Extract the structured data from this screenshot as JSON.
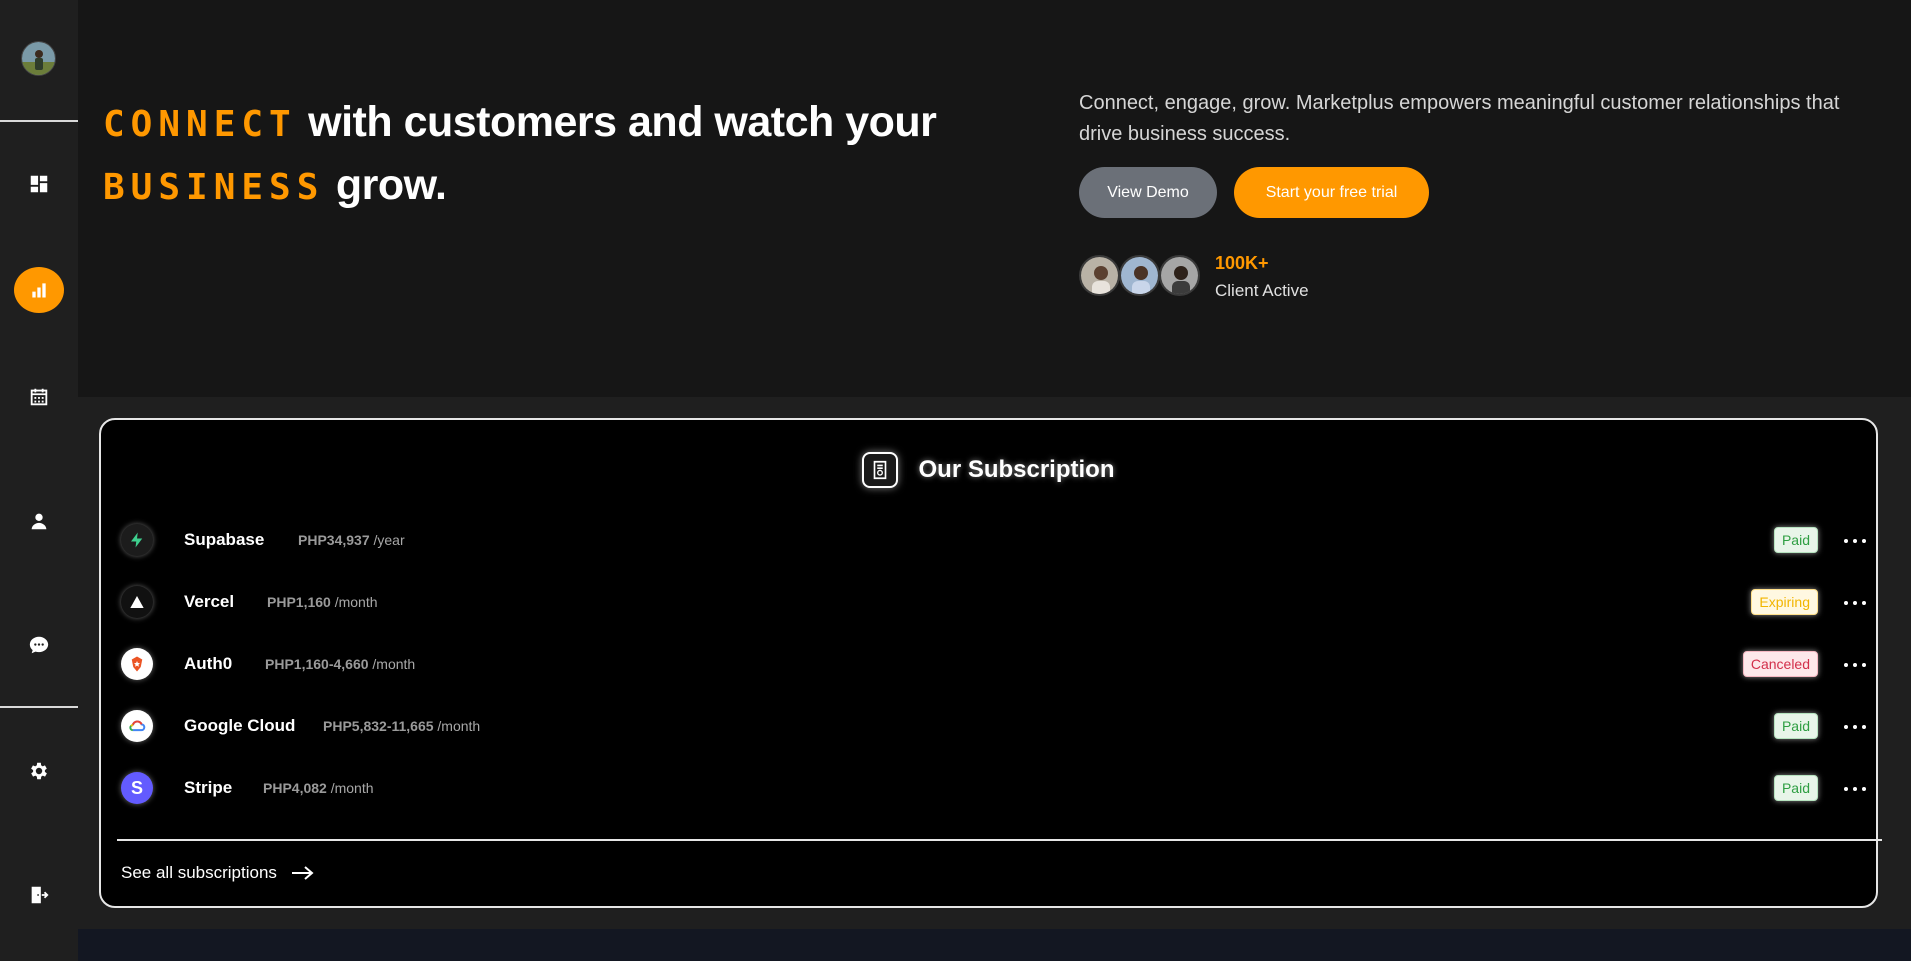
{
  "sidebar": {
    "items": [
      {
        "name": "dashboard-icon"
      },
      {
        "name": "chart-icon",
        "active": true
      },
      {
        "name": "calendar-icon"
      },
      {
        "name": "user-icon"
      },
      {
        "name": "chat-icon"
      },
      {
        "name": "gear-icon"
      },
      {
        "name": "logout-icon"
      }
    ]
  },
  "hero": {
    "headline_word1": "CONNECT",
    "headline_rest1": " with customers and watch your",
    "headline_word2": "BUSINESS",
    "headline_rest2": " grow.",
    "description": "Connect, engage, grow. Marketplus empowers meaningful customer relationships that drive business success.",
    "demo_button": "View Demo",
    "trial_button": "Start your free trial",
    "stat_value": "100K+",
    "stat_label": "Client Active"
  },
  "subscriptions": {
    "title": "Our Subscription",
    "items": [
      {
        "name": "Supabase",
        "price": "PHP34,937",
        "period": "/year",
        "status": "Paid",
        "status_type": "paid",
        "logo": "supabase-logo-icon"
      },
      {
        "name": "Vercel",
        "price": "PHP1,160",
        "period": "/month",
        "status": "Expiring",
        "status_type": "expiring",
        "logo": "vercel-logo-icon"
      },
      {
        "name": "Auth0",
        "price": "PHP1,160-4,660",
        "period": "/month",
        "status": "Canceled",
        "status_type": "canceled",
        "logo": "auth0-logo-icon"
      },
      {
        "name": "Google Cloud",
        "price": "PHP5,832-11,665",
        "period": "/month",
        "status": "Paid",
        "status_type": "paid",
        "logo": "google-cloud-logo-icon"
      },
      {
        "name": "Stripe",
        "price": "PHP4,082",
        "period": "/month",
        "status": "Paid",
        "status_type": "paid",
        "logo": "stripe-logo-icon"
      }
    ],
    "see_all": "See all subscriptions"
  },
  "colors": {
    "accent": "#ff9800",
    "sidebar_bg": "#1f1f1f",
    "hero_bg": "#161616",
    "card_bg": "#000000"
  }
}
